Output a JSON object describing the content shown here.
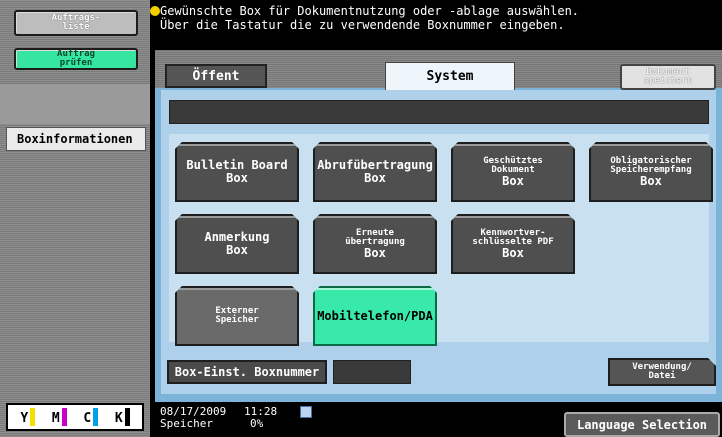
{
  "sidebar": {
    "job_list": "Auftrags-\nliste",
    "check_job": "Auftrag\nprüfen",
    "box_info": "Boxinformationen"
  },
  "toner": [
    {
      "label": "Y",
      "color": "#f4e000"
    },
    {
      "label": "M",
      "color": "#c800c8"
    },
    {
      "label": "C",
      "color": "#00a0e8"
    },
    {
      "label": "K",
      "color": "#000000"
    }
  ],
  "message": {
    "line1": "Gewünschte Box für Dokumentnutzung oder -ablage auswählen.",
    "line2": "Über die Tastatur die zu verwendende Boxnummer eingeben."
  },
  "tabs": {
    "public": "Öffent",
    "system": "System",
    "save_document": "Dokument\nspeichern"
  },
  "boxes": {
    "bulletin_board": {
      "line1": "Bulletin Board",
      "line2": "Box"
    },
    "polling_tx": {
      "line1": "Abrufübertragung",
      "line2": "Box"
    },
    "secure_doc": {
      "line1": "Geschütztes",
      "line2": "Dokument",
      "line3": "Box"
    },
    "mandatory_mem_rx": {
      "line1": "Obligatorischer",
      "line2": "Speicherempfang",
      "line3": "Box"
    },
    "annotation": {
      "line1": "Anmerkung",
      "line2": "Box"
    },
    "retransmit": {
      "line1": "Erneute",
      "line2": "übertragung",
      "line3": "Box"
    },
    "encrypted_pdf": {
      "line1": "Kennwortver-",
      "line2": "schlüsselte PDF",
      "line3": "Box"
    },
    "external_memory": {
      "line1": "Externer",
      "line2": "Speicher"
    },
    "mobile_pda": {
      "line1": "Mobiltelefon/PDA"
    }
  },
  "bottom": {
    "box_setting": "Box-Einst. Boxnummer",
    "usage_file": "Verwendung/\nDatei"
  },
  "status": {
    "date": "08/17/2009",
    "time": "11:28",
    "memory_label": "Speicher",
    "memory_pct": "0%",
    "language_selection": "Language Selection"
  }
}
